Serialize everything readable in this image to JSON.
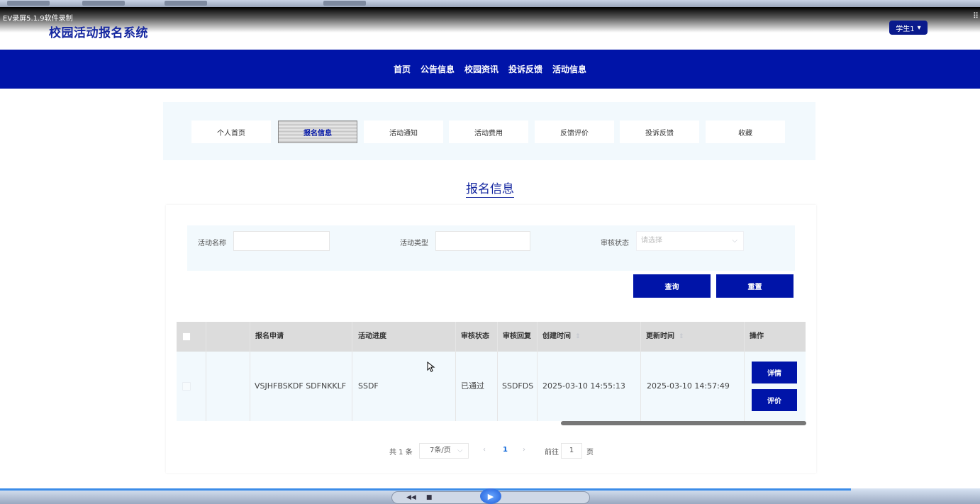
{
  "recorder": {
    "label": "EV录屏5.1.9软件录制"
  },
  "header": {
    "site_title": "校园活动报名系统",
    "user_menu": {
      "label": "学生1",
      "icon": "caret-down-icon"
    }
  },
  "main_nav": [
    "首页",
    "公告信息",
    "校园资讯",
    "投诉反馈",
    "活动信息"
  ],
  "sub_menu": {
    "items": [
      "个人首页",
      "报名信息",
      "活动通知",
      "活动费用",
      "反馈评价",
      "投诉反馈",
      "收藏"
    ],
    "active": "报名信息"
  },
  "page_heading": "报名信息",
  "search": {
    "activity_name_label": "活动名称",
    "activity_name_value": "",
    "activity_type_label": "活动类型",
    "activity_type_value": "",
    "review_status_label": "审核状态",
    "review_status_placeholder": "请选择",
    "query_button": "查询",
    "reset_button": "重置"
  },
  "table": {
    "headers": [
      "报名申请",
      "活动进度",
      "审核状态",
      "审核回复",
      "创建时间",
      "更新时间",
      "操作"
    ],
    "rows": [
      {
        "application": "VSJHFBSKDF SDFNKKLF",
        "progress": "SSDF",
        "review_status": "已通过",
        "review_reply": "SSDFDS",
        "created": "2025-03-10 14:55:13",
        "updated": "2025-03-10 14:57:49",
        "actions": [
          "详情",
          "评价"
        ]
      }
    ]
  },
  "pagination": {
    "total": "共 1 条",
    "page_size": "7条/页",
    "current_page": "1",
    "goto_label": "前往",
    "goto_value": "1",
    "page_suffix": "页"
  },
  "colors": {
    "brand": "#0014a8",
    "title": "#1628a0",
    "panel_bg": "#f2f9fd"
  }
}
